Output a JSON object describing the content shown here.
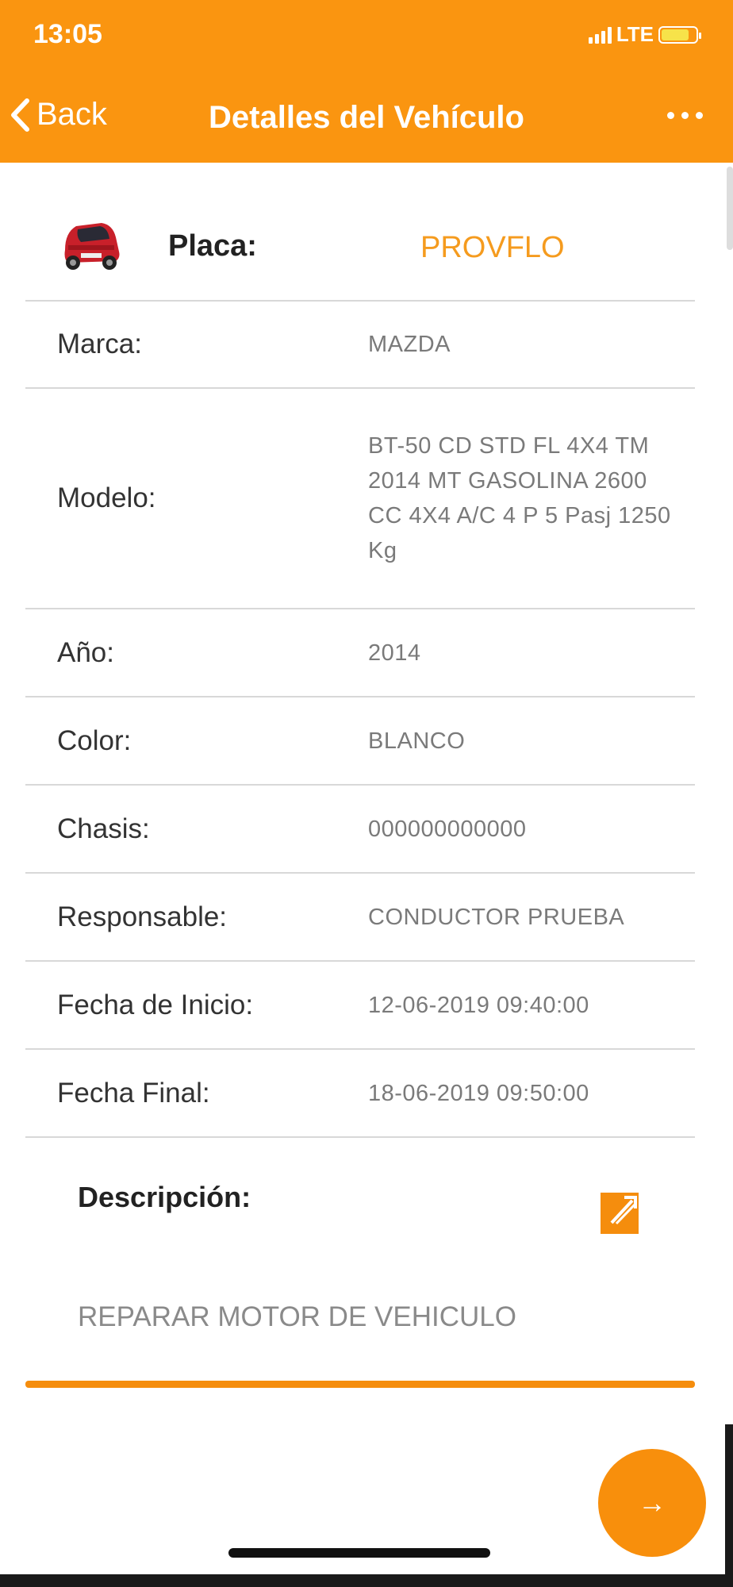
{
  "status_bar": {
    "time": "13:05",
    "network": "LTE"
  },
  "nav": {
    "back_label": "Back",
    "title": "Detalles del Vehículo"
  },
  "placa": {
    "label": "Placa:",
    "value": "PROVFLO"
  },
  "fields": [
    {
      "label": "Marca:",
      "value": "MAZDA"
    },
    {
      "label": "Modelo:",
      "value": "BT-50 CD STD FL 4X4 TM 2014 MT GASOLINA 2600 CC 4X4 A/C 4 P 5 Pasj 1250 Kg"
    },
    {
      "label": "Año:",
      "value": "2014"
    },
    {
      "label": "Color:",
      "value": "BLANCO"
    },
    {
      "label": "Chasis:",
      "value": "000000000000"
    },
    {
      "label": "Responsable:",
      "value": "CONDUCTOR PRUEBA"
    },
    {
      "label": "Fecha de Inicio:",
      "value": "12-06-2019 09:40:00"
    },
    {
      "label": "Fecha Final:",
      "value": "18-06-2019 09:50:00"
    }
  ],
  "description": {
    "label": "Descripción:",
    "value": "REPARAR MOTOR DE VEHICULO"
  },
  "fab": {
    "icon": "→"
  },
  "colors": {
    "accent": "#fa9510",
    "placa_value": "#f59b1e",
    "value_text": "#7a7a7a"
  }
}
